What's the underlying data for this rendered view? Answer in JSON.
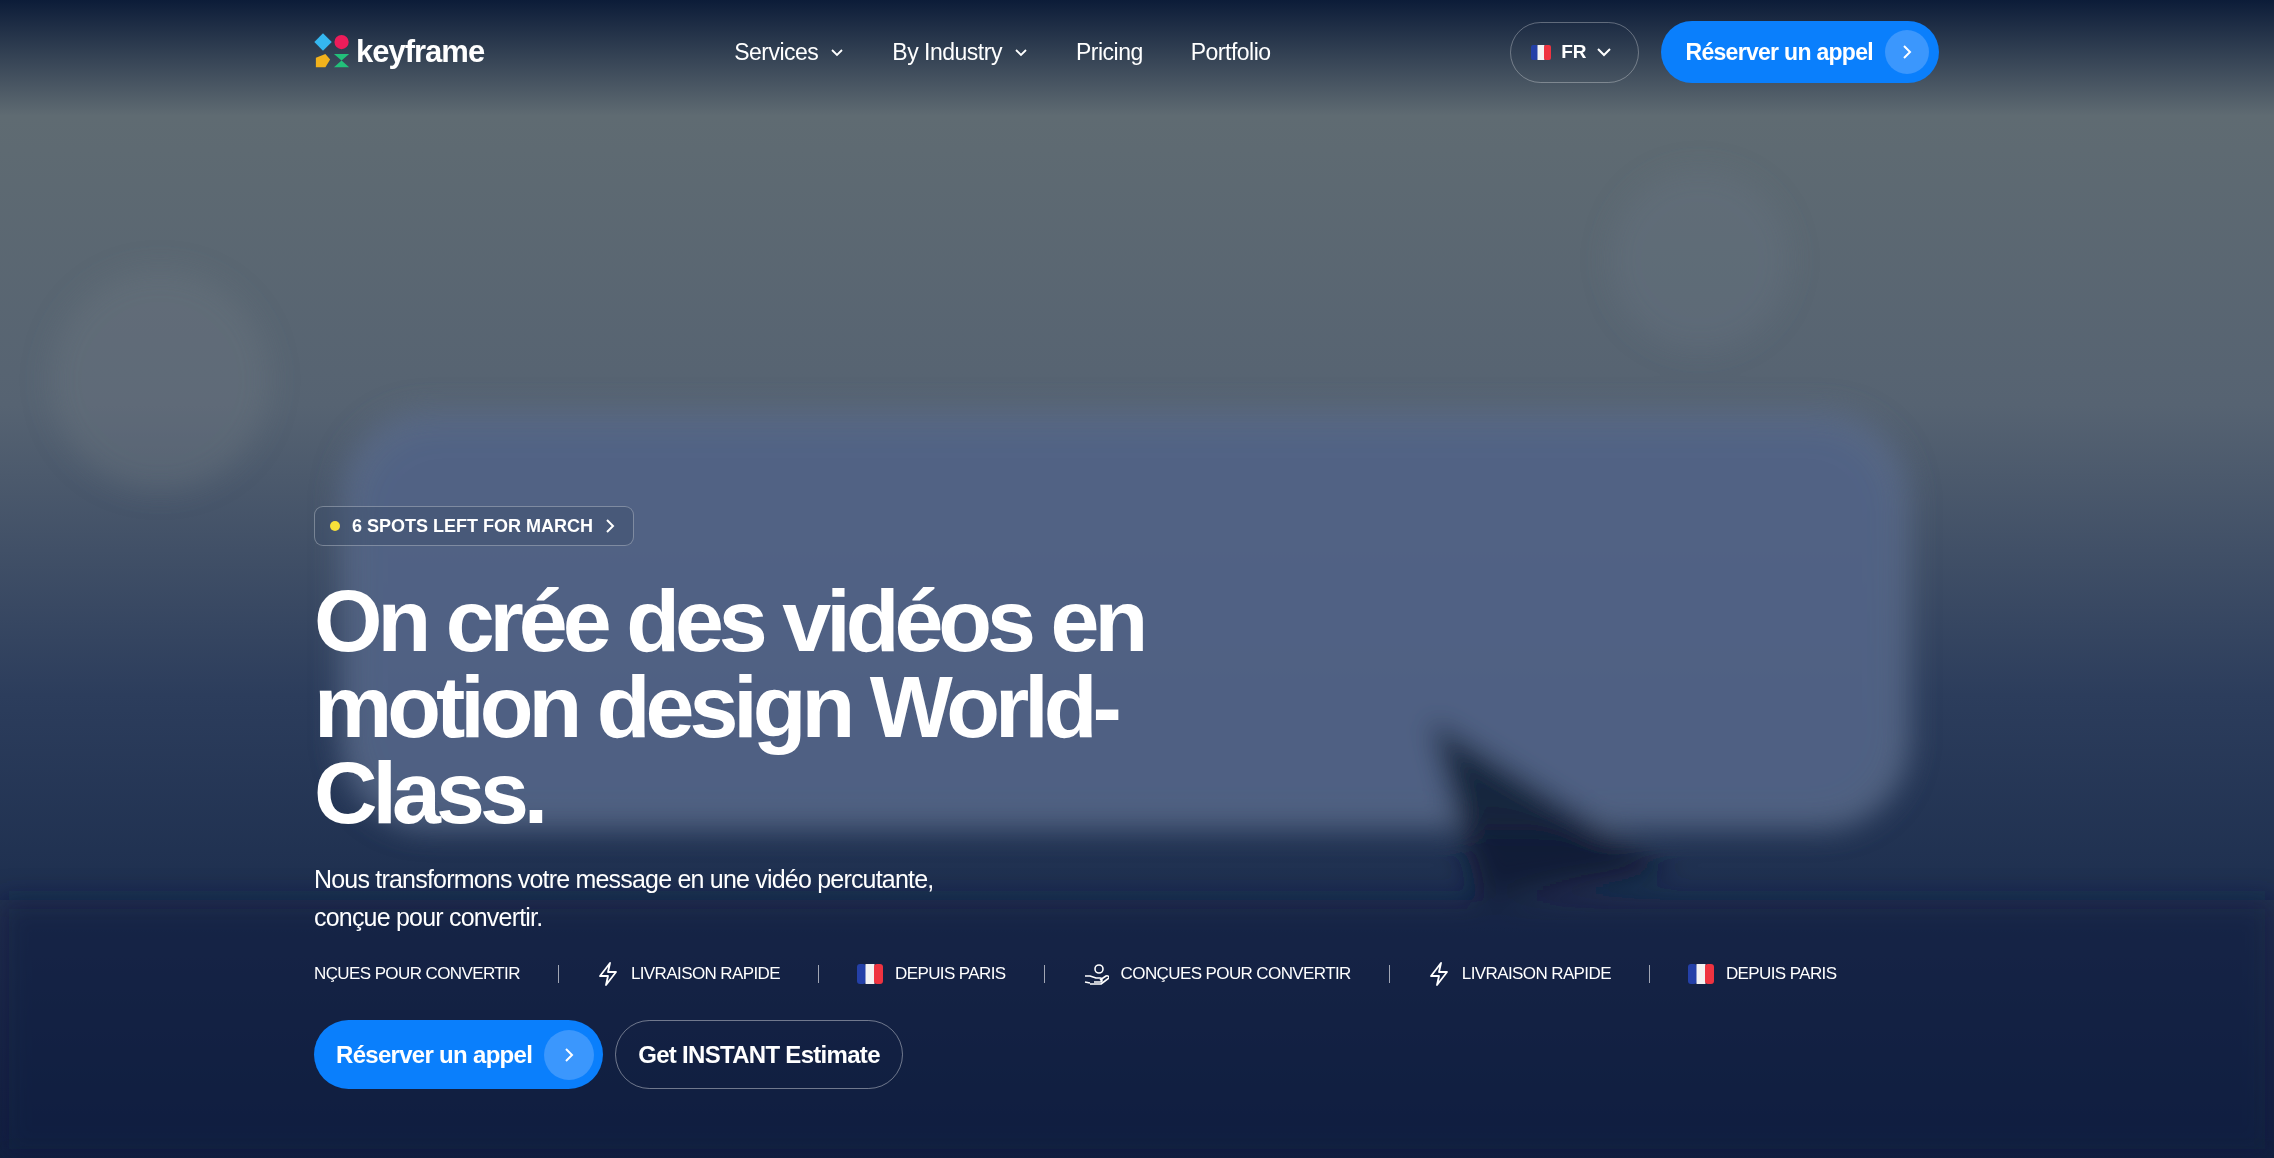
{
  "header": {
    "logo": "keyframe",
    "nav": [
      {
        "label": "Services",
        "dropdown": true
      },
      {
        "label": "By Industry",
        "dropdown": true
      },
      {
        "label": "Pricing",
        "dropdown": false
      },
      {
        "label": "Portfolio",
        "dropdown": false
      }
    ],
    "language": "FR",
    "cta": "Réserver un appel"
  },
  "hero": {
    "background": {
      "kind": "picture"
    },
    "badge": "6 SPOTS LEFT FOR MARCH",
    "title_lines": [
      "On crée des vidéos en",
      "motion design World-",
      "Class."
    ],
    "subtitle_lines": [
      "Nous transformons votre message en une vidéo percutante,",
      "conçue pour convertir."
    ],
    "features": [
      {
        "kind": "none",
        "label": "NÇUES POUR CONVERTIR"
      },
      {
        "kind": "bolt",
        "label": "LIVRAISON RAPIDE"
      },
      {
        "kind": "flag",
        "label": "DEPUIS PARIS"
      },
      {
        "kind": "hand",
        "label": "CONÇUES POUR CONVERTIR"
      },
      {
        "kind": "bolt",
        "label": "LIVRAISON RAPIDE"
      },
      {
        "kind": "flag",
        "label": "DEPUIS PARIS"
      }
    ],
    "primary_button": "Réserver un appel",
    "secondary_button": "Get INSTANT Estimate"
  }
}
